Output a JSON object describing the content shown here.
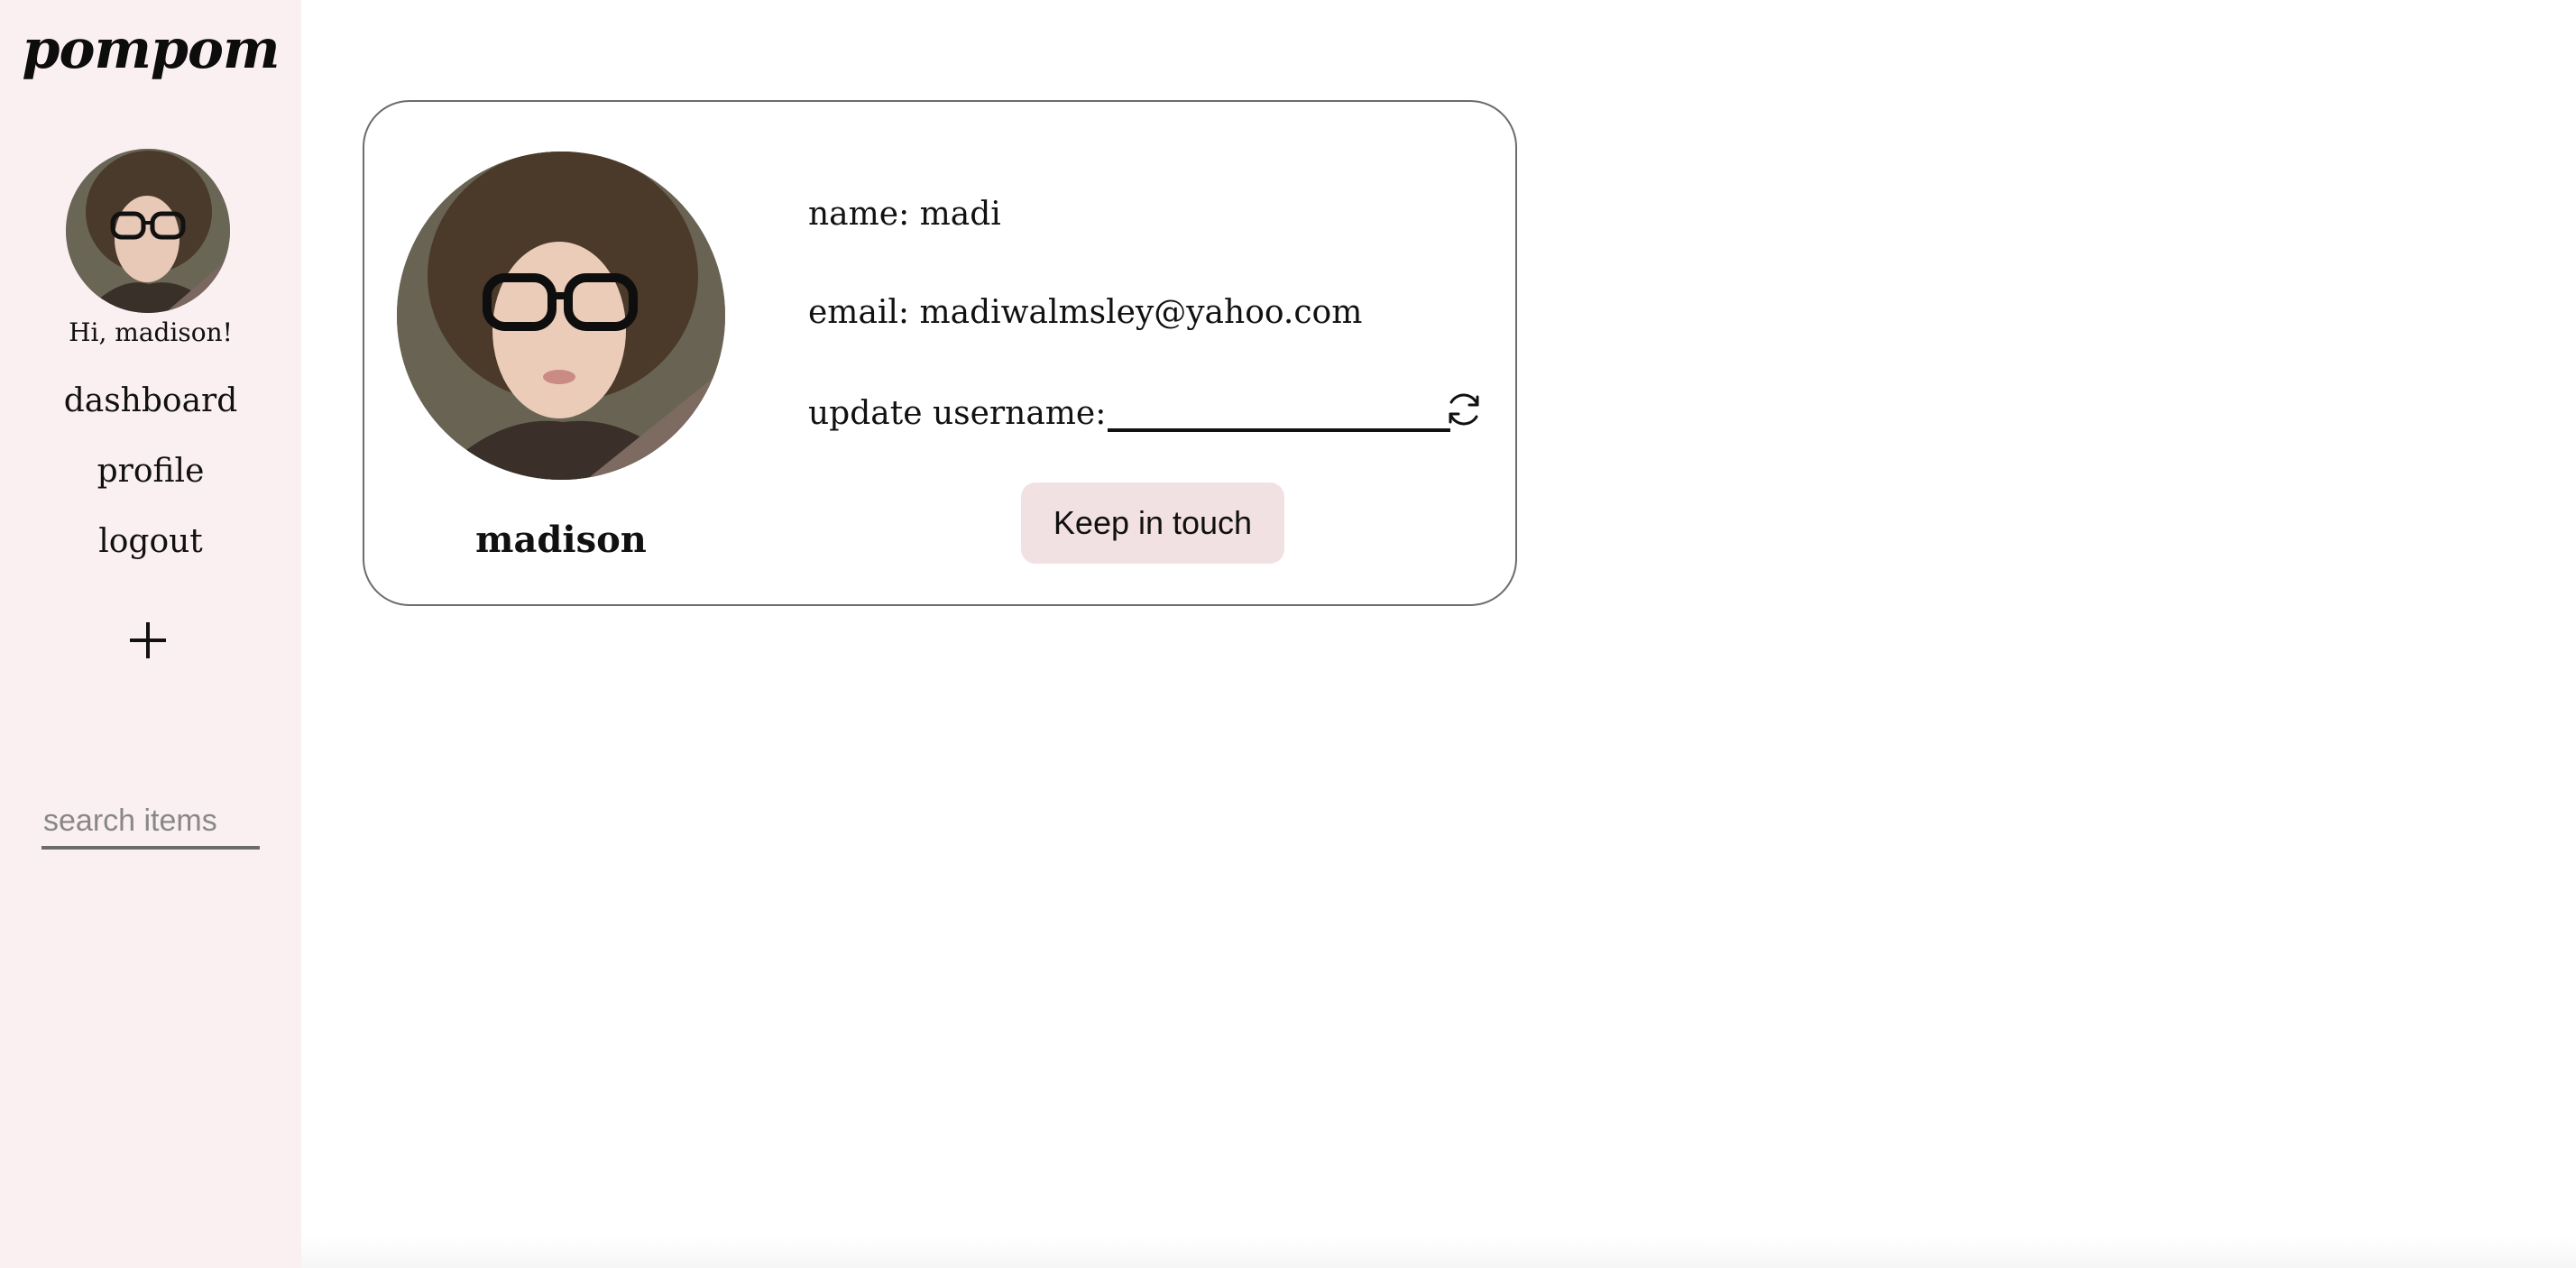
{
  "app": {
    "logo_text": "pompom"
  },
  "sidebar": {
    "greeting": "Hi, madison!",
    "nav": [
      {
        "label": "dashboard"
      },
      {
        "label": "profile"
      },
      {
        "label": "logout"
      }
    ],
    "add_icon": "plus-icon",
    "search": {
      "placeholder": "search items",
      "value": ""
    }
  },
  "profile_card": {
    "display_name": "madison",
    "name_line": "name: madi",
    "email_line": "email: madiwalmsley@yahoo.com",
    "update_label": "update username:",
    "update_value": "",
    "refresh_icon": "refresh-icon",
    "keep_button_label": "Keep in touch"
  },
  "colors": {
    "sidebar_bg": "#faf0f1",
    "button_bg": "#f2e1e3",
    "card_border": "#6c6c6c"
  }
}
